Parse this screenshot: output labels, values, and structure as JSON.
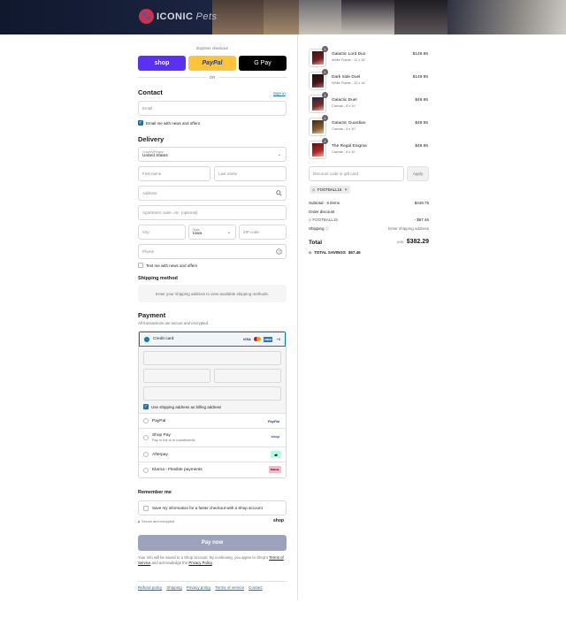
{
  "brand": {
    "name": "ICONIC",
    "script": "Pets"
  },
  "express": {
    "label": "Express checkout",
    "shop": "shop",
    "paypal": "PayPal",
    "gpay": "G Pay",
    "or": "OR"
  },
  "contact": {
    "title": "Contact",
    "sign_in": "Sign in",
    "email_placeholder": "Email",
    "news_label": "Email me with news and offers",
    "news_checked": true
  },
  "delivery": {
    "title": "Delivery",
    "country_label": "Country/Region",
    "country_value": "United States",
    "first_name": "First name",
    "last_name": "Last name",
    "address": "Address",
    "apartment": "Apartment, suite, etc. (optional)",
    "city": "City",
    "state_label": "State",
    "state_value": "Iowa",
    "zip": "ZIP code",
    "phone": "Phone",
    "sms_label": "Text me with news and offers"
  },
  "shipping": {
    "title": "Shipping method",
    "message": "Enter your shipping address to view available shipping methods."
  },
  "payment": {
    "title": "Payment",
    "subtitle": "All transactions are secure and encrypted.",
    "credit_card": "Credit card",
    "more_cards": "+5",
    "card_brands": [
      "VISA",
      "MC",
      "AMEX"
    ],
    "billing_same": "Use shipping address as billing address",
    "paypal": "PayPal",
    "paypal_logo": "PayPal",
    "shoppay": "Shop Pay",
    "shoppay_sub": "Pay in full or in installments",
    "shoppay_logo": "shop",
    "afterpay": "Afterpay",
    "klarna": "Klarna - Flexible payments",
    "klarna_logo": "Klarna."
  },
  "remember": {
    "title": "Remember me",
    "label": "Save my information for a faster checkout with a Shop account",
    "secure": "Secure and encrypted",
    "shop_logo": "shop"
  },
  "paynow": "Pay now",
  "fine_print": {
    "pre": "Your info will be saved to a Shop account. By continuing, you agree to Shop's",
    "terms": "Terms of Service",
    "mid": "and acknowledge the",
    "privacy": "Privacy Policy",
    "end": "."
  },
  "footer": [
    "Refund policy",
    "Shipping",
    "Privacy policy",
    "Terms of service",
    "Contact"
  ],
  "cart": {
    "items": [
      {
        "name": "Galactic Lord Duo",
        "variant": "White Frame - 12 x 16",
        "price": "$149.95",
        "qty": "1"
      },
      {
        "name": "Dark Side Duel",
        "variant": "White Frame - 12 x 16",
        "price": "$149.95",
        "qty": "1"
      },
      {
        "name": "Galactic Duel",
        "variant": "Canvas - 8 x 10",
        "price": "$49.95",
        "qty": "1"
      },
      {
        "name": "Galactic Guardian",
        "variant": "Canvas - 8 x 10",
        "price": "$49.95",
        "qty": "1"
      },
      {
        "name": "The Regal Enigma",
        "variant": "Canvas - 8 x 10",
        "price": "$49.95",
        "qty": "1"
      }
    ],
    "discount_placeholder": "Discount code or gift card",
    "apply": "Apply",
    "code": "FOOTBALL15",
    "subtotal_label": "Subtotal · 5 items",
    "subtotal": "$449.75",
    "order_discount_label": "Order discount",
    "discount_code": "FOOTBALL15",
    "discount_amount": "- $67.46",
    "shipping_label": "Shipping",
    "shipping_value": "Enter shipping address",
    "total_label": "Total",
    "currency": "USD",
    "total": "$382.29",
    "savings_label": "TOTAL SAVINGS",
    "savings": "$67.46"
  }
}
